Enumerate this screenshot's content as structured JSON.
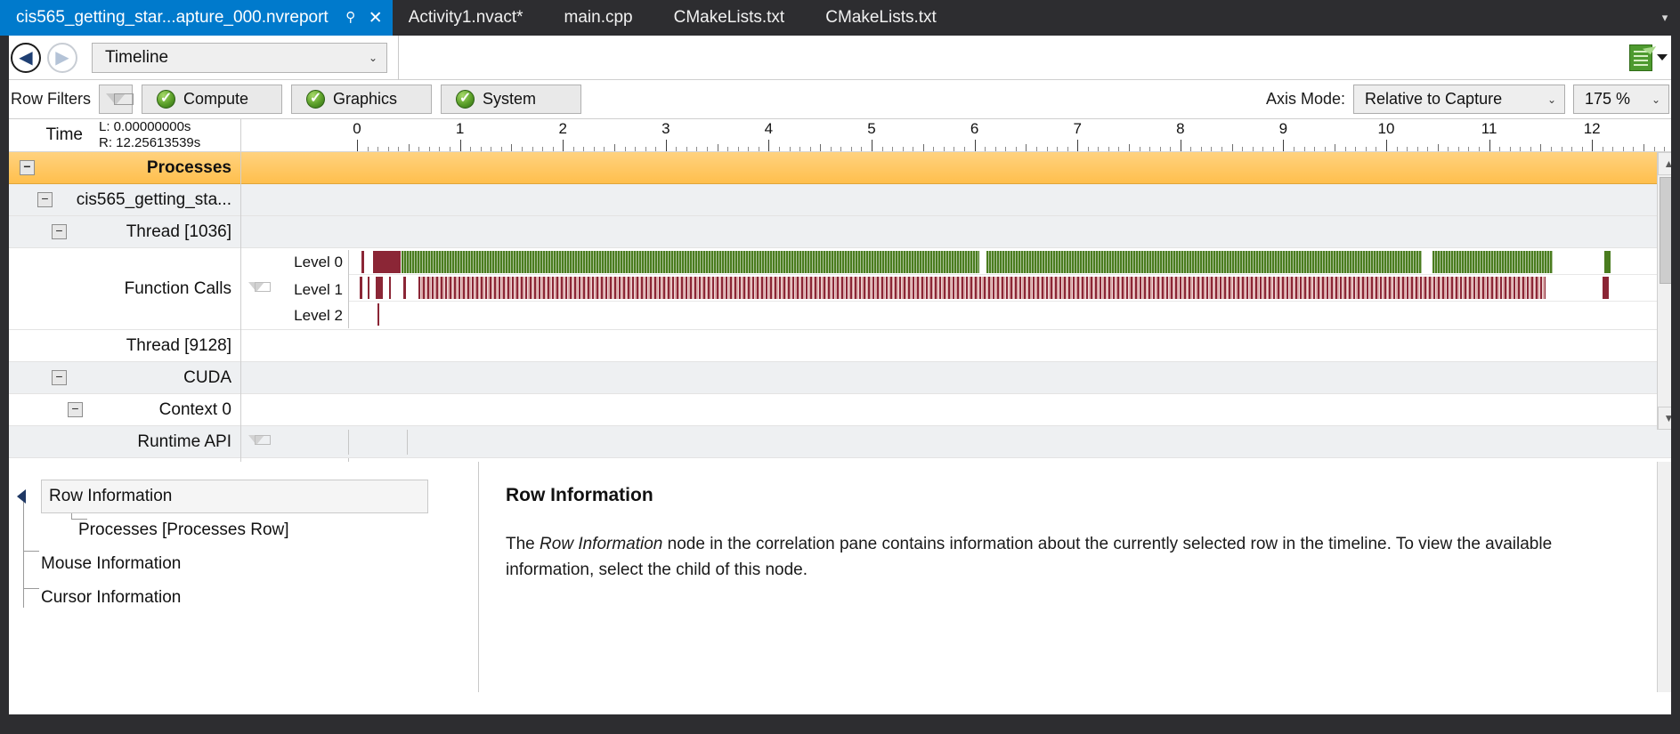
{
  "tabs": [
    {
      "label": "cis565_getting_star...apture_000.nvreport",
      "active": true,
      "pin": "pin-icon",
      "close": "close-icon"
    },
    {
      "label": "Activity1.nvact*",
      "active": false
    },
    {
      "label": "main.cpp",
      "active": false
    },
    {
      "label": "CMakeLists.txt",
      "active": false
    },
    {
      "label": "CMakeLists.txt",
      "active": false
    }
  ],
  "tab_overflow_glyph": "▾",
  "navbar": {
    "back_glyph": "◀",
    "forward_glyph": "▶",
    "view": "Timeline",
    "caret": "⌄",
    "report_caret": "▾"
  },
  "filterbar": {
    "row_filters_label": "Row Filters",
    "buttons": [
      {
        "label": "Compute"
      },
      {
        "label": "Graphics"
      },
      {
        "label": "System"
      }
    ],
    "axis_mode_label": "Axis Mode:",
    "axis_mode_value": "Relative to Capture",
    "zoom_value": "175 %",
    "caret": "⌄"
  },
  "timeline": {
    "time_label": "Time",
    "range_left": "L: 0.00000000s",
    "range_right": "R: 12.25613539s",
    "ruler_ticks": [
      "0",
      "1",
      "2",
      "3",
      "4",
      "5",
      "6",
      "7",
      "8",
      "9",
      "10",
      "11",
      "12"
    ],
    "rows": [
      {
        "label": "Processes",
        "indent": 0,
        "expander": "−",
        "selected": true,
        "shade": "selected"
      },
      {
        "label": "cis565_getting_sta...",
        "indent": 1,
        "expander": "−",
        "selected": false,
        "shade": "alt"
      },
      {
        "label": "Thread [1036]",
        "indent": 2,
        "expander": "−",
        "selected": false,
        "shade": "alt"
      },
      {
        "label": "Thread [9128]",
        "indent": 2,
        "expander": "",
        "selected": false,
        "shade": "white"
      },
      {
        "label": "CUDA",
        "indent": 2,
        "expander": "−",
        "selected": false,
        "shade": "alt"
      },
      {
        "label": "Context 0",
        "indent": 3,
        "expander": "−",
        "selected": false,
        "shade": "white"
      },
      {
        "label": "Runtime API",
        "indent": 4,
        "expander": "",
        "selected": false,
        "shade": "alt"
      }
    ],
    "function_calls_label": "Function Calls",
    "levels": [
      "Level 0",
      "Level 1",
      "Level 2"
    ],
    "scroll_up_glyph": "▲",
    "scroll_down_glyph": "▼",
    "hscroll_left_glyph": "◀",
    "hscroll_right_glyph": "▶",
    "hscroll_grip": "|||"
  },
  "correlation": {
    "nodes": [
      {
        "label": "Row Information",
        "level": 0,
        "selected": true
      },
      {
        "label": "Processes [Processes Row]",
        "level": 1,
        "selected": false
      },
      {
        "label": "Mouse Information",
        "level": 0,
        "selected": false
      },
      {
        "label": "Cursor Information",
        "level": 0,
        "selected": false
      }
    ],
    "detail_title": "Row Information",
    "detail_prefix": "The ",
    "detail_italic": "Row Information",
    "detail_suffix": " node in the correlation pane contains information about the currently selected row in the timeline. To view the available information, select the child of this node."
  },
  "colors": {
    "accent_blue": "#007acc",
    "chrome_dark": "#2d2d30",
    "selection_orange": "#ffbf4d",
    "bar_green": "#4a7c1f",
    "bar_darkred": "#8b2636",
    "bar_pink": "#d9a7a7"
  },
  "chart_data": {
    "type": "timeline",
    "xlabel": "Time (s)",
    "xlim": [
      0,
      12.4
    ],
    "lanes": [
      {
        "name": "Level 0",
        "spans": [
          {
            "start": 0.04,
            "end": 0.07,
            "color": "#8b2636"
          },
          {
            "start": 0.16,
            "end": 0.42,
            "color": "#8b2636"
          },
          {
            "start": 0.43,
            "end": 6.05,
            "color": "#4a7c1f"
          },
          {
            "start": 6.12,
            "end": 10.35,
            "color": "#4a7c1f"
          },
          {
            "start": 10.45,
            "end": 11.62,
            "color": "#4a7c1f"
          },
          {
            "start": 12.12,
            "end": 12.18,
            "color": "#4a7c1f"
          }
        ]
      },
      {
        "name": "Level 1",
        "spans": [
          {
            "start": 0.03,
            "end": 0.05,
            "color": "#8b2636"
          },
          {
            "start": 0.1,
            "end": 0.12,
            "color": "#8b2636"
          },
          {
            "start": 0.18,
            "end": 0.25,
            "color": "#8b2636"
          },
          {
            "start": 0.31,
            "end": 0.33,
            "color": "#8b2636"
          },
          {
            "start": 0.45,
            "end": 0.48,
            "color": "#8b2636"
          },
          {
            "start": 0.6,
            "end": 11.55,
            "color": "#d9a7a7"
          },
          {
            "start": 12.1,
            "end": 12.16,
            "color": "#8b2636"
          }
        ]
      },
      {
        "name": "Level 2",
        "spans": [
          {
            "start": 0.2,
            "end": 0.21,
            "color": "#8b2636"
          }
        ]
      }
    ]
  }
}
